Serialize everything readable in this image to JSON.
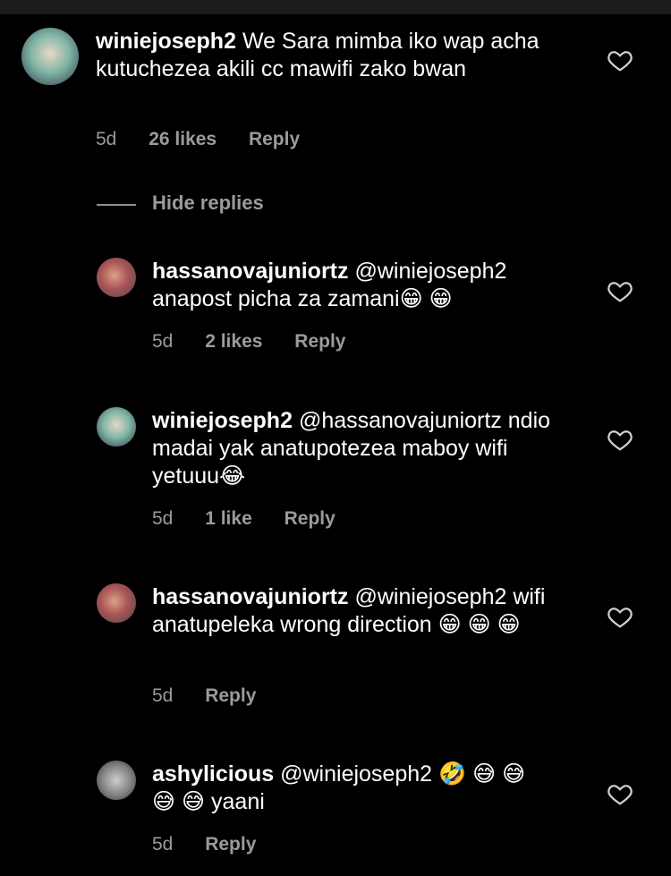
{
  "comments": [
    {
      "user": "winiejoseph2",
      "text": "We Sara mimba iko wap acha kutuchezea akili cc mawifi zako bwan",
      "time": "5d",
      "likes": "26 likes",
      "reply": "Reply"
    },
    {
      "user": "hassanovajuniortz",
      "text": "@winiejoseph2 anapost picha za zamani😁 😁",
      "time": "5d",
      "likes": "2 likes",
      "reply": "Reply"
    },
    {
      "user": "winiejoseph2",
      "text": "@hassanovajuniortz ndio madai yak anatupotezea maboy wifi yetuuu😂",
      "time": "5d",
      "likes": "1 like",
      "reply": "Reply"
    },
    {
      "user": "hassanovajuniortz",
      "text": "@winiejoseph2 wifi anatupeleka wrong direction 😁 😁 😁",
      "time": "5d",
      "reply": "Reply"
    },
    {
      "user": "ashylicious",
      "text": "@winiejoseph2 🤣 😅 😅 😅 😅 yaani",
      "time": "5d",
      "reply": "Reply"
    }
  ],
  "hide_replies": "Hide replies",
  "icons": {
    "like": "heart-outline-icon"
  }
}
